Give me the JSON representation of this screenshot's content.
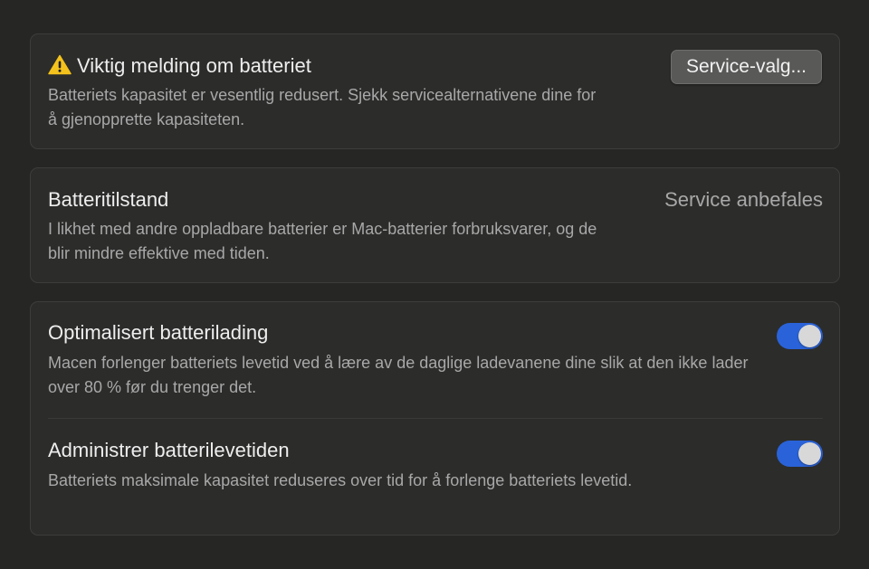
{
  "warning_card": {
    "title": "Viktig melding om batteriet",
    "description": "Batteriets kapasitet er vesentlig redusert. Sjekk servicealternativene dine for å gjenopprette kapasiteten.",
    "button_label": "Service-valg...",
    "icon": "warning-triangle-icon"
  },
  "health_card": {
    "title": "Batteritilstand",
    "status": "Service anbefales",
    "description": "I likhet med andre oppladbare batterier er Mac-batterier forbruksvarer, og de blir mindre effektive med tiden."
  },
  "settings_card": {
    "items": [
      {
        "title": "Optimalisert batterilading",
        "description": "Macen forlenger batteriets levetid ved å lære av de daglige ladevanene dine slik at den ikke lader over 80 % før du trenger det.",
        "enabled": true
      },
      {
        "title": "Administrer batterilevetiden",
        "description": "Batteriets maksimale kapasitet reduseres over tid for å forlenge batteriets levetid.",
        "enabled": true
      }
    ]
  },
  "colors": {
    "toggle_on": "#2a63d9",
    "warning": "#f4c21c"
  }
}
